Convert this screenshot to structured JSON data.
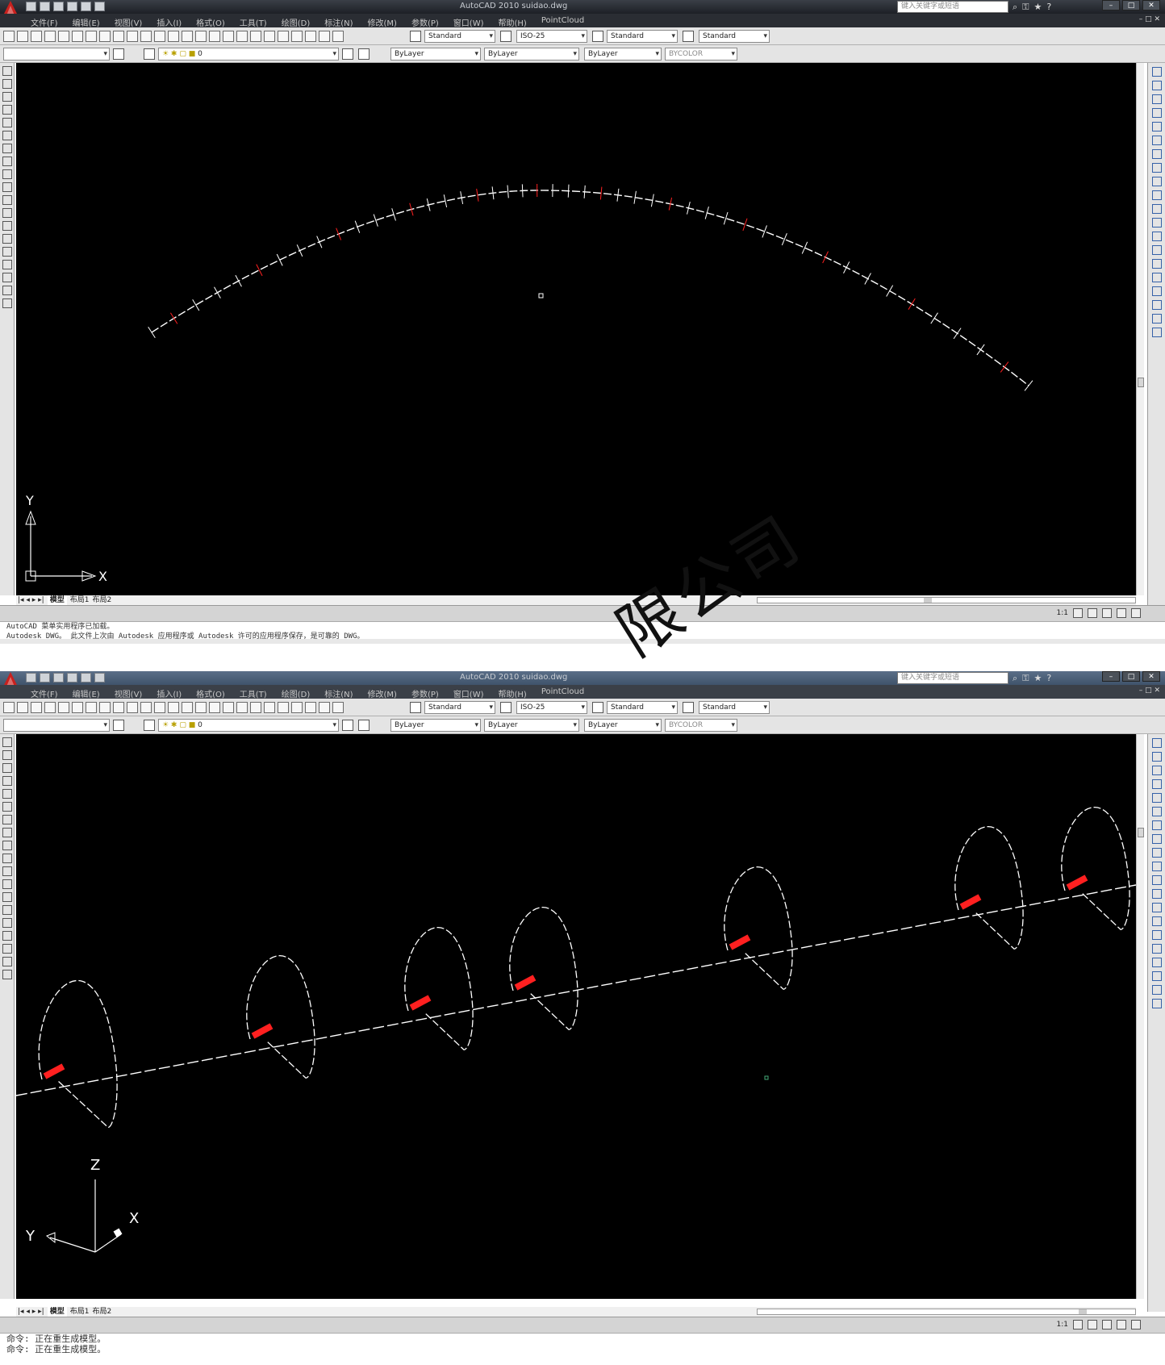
{
  "top": {
    "title": "AutoCAD 2010     suidao.dwg",
    "search_placeholder": "键入关键字或短语",
    "menu": [
      "文件(F)",
      "编辑(E)",
      "视图(V)",
      "插入(I)",
      "格式(O)",
      "工具(T)",
      "绘图(D)",
      "标注(N)",
      "修改(M)",
      "参数(P)",
      "窗口(W)",
      "帮助(H)",
      "PointCloud"
    ],
    "toolbar": {
      "text_style": "Standard",
      "dim_style": "ISO-25",
      "table_style": "Standard",
      "multileader_style": "Standard",
      "layer": "0",
      "color": "ByLayer",
      "linetype": "ByLayer",
      "lineweight": "ByLayer",
      "plotstyle": "BYCOLOR"
    },
    "ucs": {
      "x_label": "X",
      "y_label": "Y"
    },
    "tabs": [
      "模型",
      "布局1",
      "布局2"
    ],
    "status_scale": "1:1",
    "command_lines": [
      "AutoCAD 菜单实用程序已加载。",
      "Autodesk DWG。  此文件上次由 Autodesk 应用程序或 Autodesk 许可的应用程序保存，是可靠的 DWG。"
    ]
  },
  "bottom": {
    "title": "AutoCAD 2010     suidao.dwg",
    "search_placeholder": "键入关键字或短语",
    "menu": [
      "文件(F)",
      "编辑(E)",
      "视图(V)",
      "插入(I)",
      "格式(O)",
      "工具(T)",
      "绘图(D)",
      "标注(N)",
      "修改(M)",
      "参数(P)",
      "窗口(W)",
      "帮助(H)",
      "PointCloud"
    ],
    "toolbar": {
      "text_style": "Standard",
      "dim_style": "ISO-25",
      "table_style": "Standard",
      "multileader_style": "Standard",
      "layer": "0",
      "color": "ByLayer",
      "linetype": "ByLayer",
      "lineweight": "ByLayer",
      "plotstyle": "BYCOLOR"
    },
    "ucs": {
      "x_label": "X",
      "y_label": "Y",
      "z_label": "Z"
    },
    "tabs": [
      "模型",
      "布局1",
      "布局2"
    ],
    "status_scale": "1:1",
    "command_lines": [
      "命令:  正在重生成模型。",
      "命令:  正在重生成模型。"
    ]
  },
  "watermark": "限公司",
  "colors": {
    "canvas": "#000000",
    "line": "#ffffff",
    "marker": "#ff2020"
  }
}
